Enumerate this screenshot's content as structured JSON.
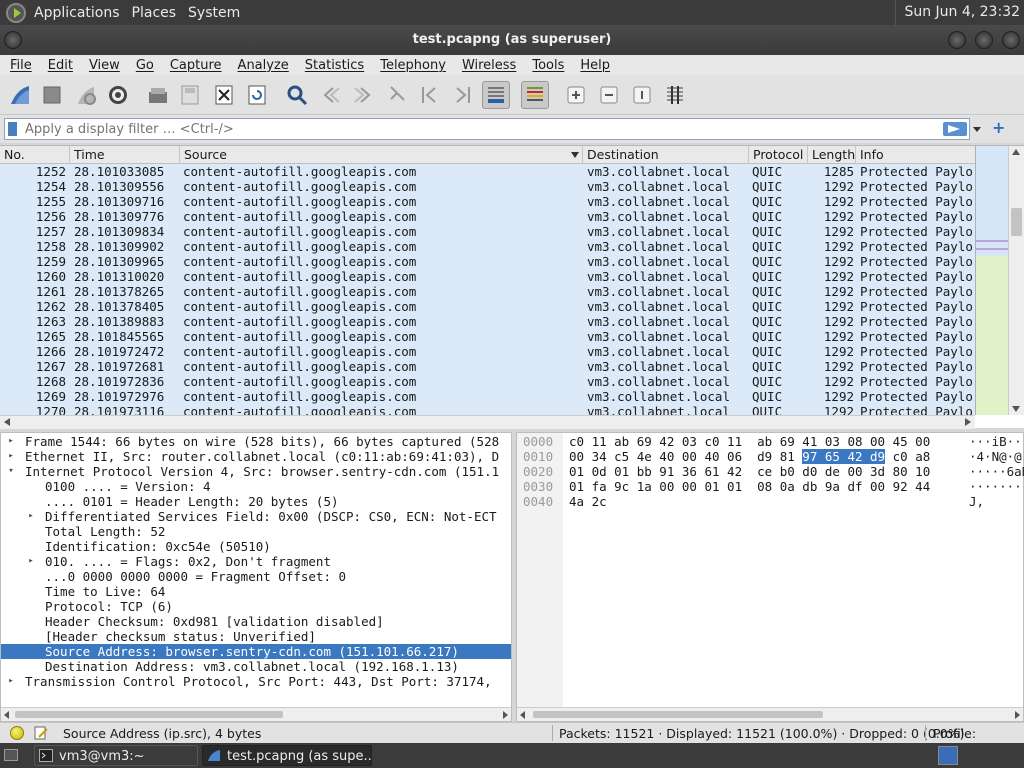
{
  "top_panel": {
    "menus": [
      "Applications",
      "Places",
      "System"
    ],
    "clock": "Sun Jun  4, 23:32"
  },
  "window": {
    "title": "test.pcapng (as superuser)"
  },
  "menubar": [
    "File",
    "Edit",
    "View",
    "Go",
    "Capture",
    "Analyze",
    "Statistics",
    "Telephony",
    "Wireless",
    "Tools",
    "Help"
  ],
  "toolbar": {
    "icons": [
      "start-capture-icon",
      "stop-capture-icon",
      "restart-capture-icon",
      "capture-options-icon",
      "open-file-icon",
      "save-file-icon",
      "close-file-icon",
      "reload-file-icon",
      "find-packet-icon",
      "go-back-icon",
      "go-forward-icon",
      "go-to-packet-icon",
      "first-packet-icon",
      "last-packet-icon",
      "autoscroll-icon",
      "colorize-icon",
      "zoom-in-icon",
      "zoom-out-icon",
      "normal-size-icon",
      "resize-columns-icon"
    ]
  },
  "filter": {
    "placeholder": "Apply a display filter … <Ctrl-/>",
    "value": ""
  },
  "packet_list": {
    "columns": [
      "No.",
      "Time",
      "Source",
      "Destination",
      "Protocol",
      "Length",
      "Info"
    ],
    "rows": [
      [
        "1252",
        "28.101033085",
        "content-autofill.googleapis.com",
        "vm3.collabnet.local",
        "QUIC",
        "1285",
        "Protected Paylo"
      ],
      [
        "1254",
        "28.101309556",
        "content-autofill.googleapis.com",
        "vm3.collabnet.local",
        "QUIC",
        "1292",
        "Protected Paylo"
      ],
      [
        "1255",
        "28.101309716",
        "content-autofill.googleapis.com",
        "vm3.collabnet.local",
        "QUIC",
        "1292",
        "Protected Paylo"
      ],
      [
        "1256",
        "28.101309776",
        "content-autofill.googleapis.com",
        "vm3.collabnet.local",
        "QUIC",
        "1292",
        "Protected Paylo"
      ],
      [
        "1257",
        "28.101309834",
        "content-autofill.googleapis.com",
        "vm3.collabnet.local",
        "QUIC",
        "1292",
        "Protected Paylo"
      ],
      [
        "1258",
        "28.101309902",
        "content-autofill.googleapis.com",
        "vm3.collabnet.local",
        "QUIC",
        "1292",
        "Protected Paylo"
      ],
      [
        "1259",
        "28.101309965",
        "content-autofill.googleapis.com",
        "vm3.collabnet.local",
        "QUIC",
        "1292",
        "Protected Paylo"
      ],
      [
        "1260",
        "28.101310020",
        "content-autofill.googleapis.com",
        "vm3.collabnet.local",
        "QUIC",
        "1292",
        "Protected Paylo"
      ],
      [
        "1261",
        "28.101378265",
        "content-autofill.googleapis.com",
        "vm3.collabnet.local",
        "QUIC",
        "1292",
        "Protected Paylo"
      ],
      [
        "1262",
        "28.101378405",
        "content-autofill.googleapis.com",
        "vm3.collabnet.local",
        "QUIC",
        "1292",
        "Protected Paylo"
      ],
      [
        "1263",
        "28.101389883",
        "content-autofill.googleapis.com",
        "vm3.collabnet.local",
        "QUIC",
        "1292",
        "Protected Paylo"
      ],
      [
        "1265",
        "28.101845565",
        "content-autofill.googleapis.com",
        "vm3.collabnet.local",
        "QUIC",
        "1292",
        "Protected Paylo"
      ],
      [
        "1266",
        "28.101972472",
        "content-autofill.googleapis.com",
        "vm3.collabnet.local",
        "QUIC",
        "1292",
        "Protected Paylo"
      ],
      [
        "1267",
        "28.101972681",
        "content-autofill.googleapis.com",
        "vm3.collabnet.local",
        "QUIC",
        "1292",
        "Protected Paylo"
      ],
      [
        "1268",
        "28.101972836",
        "content-autofill.googleapis.com",
        "vm3.collabnet.local",
        "QUIC",
        "1292",
        "Protected Paylo"
      ],
      [
        "1269",
        "28.101972976",
        "content-autofill.googleapis.com",
        "vm3.collabnet.local",
        "QUIC",
        "1292",
        "Protected Paylo"
      ],
      [
        "1270",
        "28.101973116",
        "content-autofill.googleapis.com",
        "vm3.collabnet.local",
        "QUIC",
        "1292",
        "Protected Paylo"
      ]
    ]
  },
  "details": {
    "lines": [
      {
        "indent": 0,
        "twisty": "right",
        "text": "Frame 1544: 66 bytes on wire (528 bits), 66 bytes captured (528"
      },
      {
        "indent": 0,
        "twisty": "right",
        "text": "Ethernet II, Src: router.collabnet.local (c0:11:ab:69:41:03), D"
      },
      {
        "indent": 0,
        "twisty": "down",
        "text": "Internet Protocol Version 4, Src: browser.sentry-cdn.com (151.1"
      },
      {
        "indent": 1,
        "twisty": "",
        "text": "0100 .... = Version: 4"
      },
      {
        "indent": 1,
        "twisty": "",
        "text": ".... 0101 = Header Length: 20 bytes (5)"
      },
      {
        "indent": 1,
        "twisty": "right",
        "text": "Differentiated Services Field: 0x00 (DSCP: CS0, ECN: Not-ECT"
      },
      {
        "indent": 1,
        "twisty": "",
        "text": "Total Length: 52"
      },
      {
        "indent": 1,
        "twisty": "",
        "text": "Identification: 0xc54e (50510)"
      },
      {
        "indent": 1,
        "twisty": "right",
        "text": "010. .... = Flags: 0x2, Don't fragment"
      },
      {
        "indent": 1,
        "twisty": "",
        "text": "...0 0000 0000 0000 = Fragment Offset: 0"
      },
      {
        "indent": 1,
        "twisty": "",
        "text": "Time to Live: 64"
      },
      {
        "indent": 1,
        "twisty": "",
        "text": "Protocol: TCP (6)"
      },
      {
        "indent": 1,
        "twisty": "",
        "text": "Header Checksum: 0xd981 [validation disabled]"
      },
      {
        "indent": 1,
        "twisty": "",
        "text": "[Header checksum status: Unverified]"
      },
      {
        "indent": 1,
        "twisty": "",
        "text": "Source Address: browser.sentry-cdn.com (151.101.66.217)",
        "selected": true
      },
      {
        "indent": 1,
        "twisty": "",
        "text": "Destination Address: vm3.collabnet.local (192.168.1.13)"
      },
      {
        "indent": 0,
        "twisty": "right",
        "text": "Transmission Control Protocol, Src Port: 443, Dst Port: 37174,"
      }
    ]
  },
  "bytes": {
    "lines": [
      {
        "offset": "0000",
        "hex_a": "c0 11 ab 69 42 03 c0 11  ab 69 41 03 08 00 45 00",
        "hex_hl": "",
        "hex_b": "",
        "ascii": "···iB···"
      },
      {
        "offset": "0010",
        "hex_a": "00 34 c5 4e 40 00 40 06  d9 81 ",
        "hex_hl": "97 65 42 d9",
        "hex_b": " c0 a8",
        "ascii": "·4·N@·@·"
      },
      {
        "offset": "0020",
        "hex_a": "01 0d 01 bb 91 36 61 42  ce b0 d0 de 00 3d 80 10",
        "hex_hl": "",
        "hex_b": "",
        "ascii": "·····6aB"
      },
      {
        "offset": "0030",
        "hex_a": "01 fa 9c 1a 00 00 01 01  08 0a db 9a df 00 92 44",
        "hex_hl": "",
        "hex_b": "",
        "ascii": "········"
      },
      {
        "offset": "0040",
        "hex_a": "4a 2c",
        "hex_hl": "",
        "hex_b": "",
        "ascii": "J,"
      }
    ]
  },
  "status": {
    "field": "Source Address (ip.src), 4 bytes",
    "packets": "Packets: 11521 · Displayed: 11521 (100.0%) · Dropped: 0 (0.0%)",
    "profile": "Profile: Default"
  },
  "taskbar": {
    "tasks": [
      "vm3@vm3:~",
      "test.pcapng (as supe..."
    ]
  },
  "colors": {
    "row_bg": "#dbe9f8",
    "selection": "#3a78c2",
    "panel": "#3b3b3b"
  }
}
